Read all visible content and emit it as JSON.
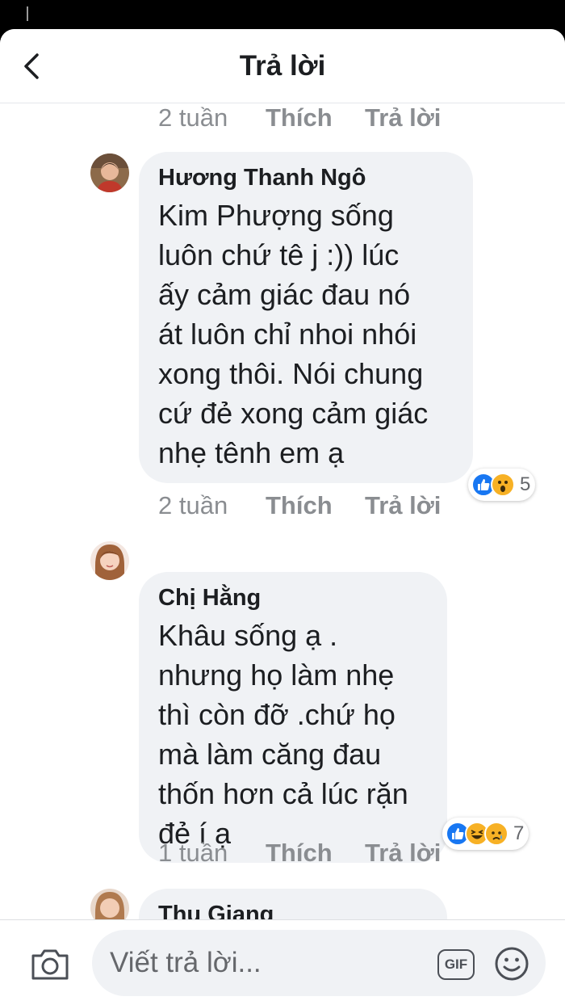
{
  "header": {
    "title": "Trả lời"
  },
  "top_actions": {
    "time": "2 tuần",
    "like": "Thích",
    "reply": "Trả lời"
  },
  "comments": [
    {
      "author": "Hương Thanh Ngô",
      "text": "Kim Phượng sống\nluôn chứ tê j :)) lúc\nấy cảm giác đau nó\nát luôn chỉ nhoi nhói\nxong thôi. Nói chung\ncứ đẻ xong cảm giác\nnhẹ tênh em ạ",
      "reactions": [
        "like",
        "wow"
      ],
      "reaction_count": "5",
      "time": "2 tuần",
      "like": "Thích",
      "reply": "Trả lời"
    },
    {
      "author": "Chị Hằng",
      "text": "Khâu sống ạ .\nnhưng họ làm nhẹ\nthì còn đỡ .chứ họ\nmà làm căng đau\nthốn hơn cả lúc rặn\nđẻ í ạ",
      "reactions": [
        "like",
        "haha",
        "sad"
      ],
      "reaction_count": "7",
      "time": "1 tuần",
      "like": "Thích",
      "reply": "Trả lời"
    },
    {
      "author": "Thu Giang"
    }
  ],
  "composer": {
    "placeholder": "Viết trả lời...",
    "gif_label": "GIF"
  },
  "colors": {
    "facebook_blue": "#1877f2",
    "bubble": "#f0f2f5",
    "muted": "#8a8d91",
    "reaction_yellow": "#f7b125"
  }
}
